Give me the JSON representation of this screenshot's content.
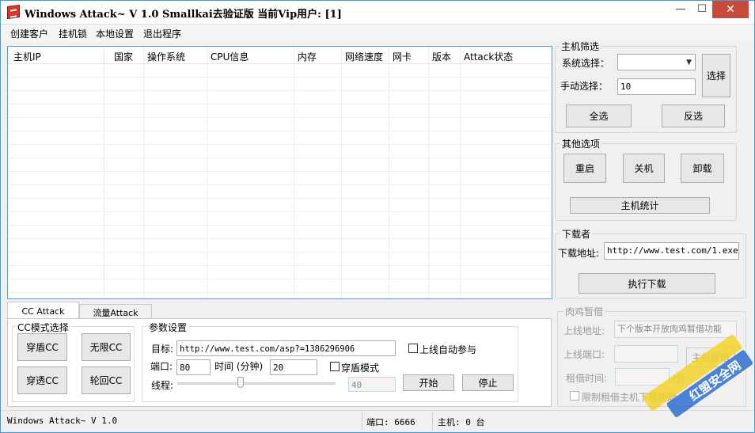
{
  "window": {
    "title": "Windows Attack~  V 1.0 Smallkai去验证版 当前Vip用户: [1]",
    "minimize": "—",
    "maximize": "☐",
    "close": "✕"
  },
  "menu": [
    "创建客户",
    "挂机锁",
    "本地设置",
    "退出程序"
  ],
  "hostlist": {
    "columns": [
      "主机IP",
      "国家",
      "操作系统",
      "CPU信息",
      "内存",
      "网络速度",
      "网卡",
      "版本",
      "Attack状态"
    ]
  },
  "host_filter": {
    "title": "主机筛选",
    "system_select_label": "系统选择：",
    "system_select_value": "",
    "manual_select_label": "手动选择：",
    "manual_select_value": "10",
    "select_button": "选择",
    "select_all": "全选",
    "invert": "反选"
  },
  "other_options": {
    "title": "其他选项",
    "restart": "重启",
    "shutdown": "关机",
    "uninstall": "卸载",
    "host_stats": "主机统计"
  },
  "downloader": {
    "title": "下载者",
    "url_label": "下载地址:",
    "url_value": "http://www.test.com/1.exe",
    "execute": "执行下载"
  },
  "borrow": {
    "title": "肉鸡暂借",
    "online_addr_label": "上线地址:",
    "online_addr_value": "下个版本开放肉鸡暂借功能",
    "online_port_label": "上线端口:",
    "online_port_value": "",
    "host_button": "主机暂借",
    "borrow_time_label": "租借时间:",
    "borrow_time_value": "",
    "minute_unit": "/分",
    "limit_download": "限制租借主机下载功能"
  },
  "tabs": [
    "CC Attack",
    "流量Attack"
  ],
  "cc_mode": {
    "title": "CC模式选择",
    "shield_cc": "穿盾CC",
    "unlimited_cc": "无限CC",
    "penetrate_cc": "穿透CC",
    "rotate_cc": "轮回CC"
  },
  "params": {
    "title": "参数设置",
    "target_label": "目标:",
    "target_value": "http://www.test.com/asp?=1386296906",
    "auto_join": "上线自动参与",
    "port_label": "端口:",
    "port_value": "80",
    "time_label": "时间 (分钟)",
    "time_value": "20",
    "shield_mode": "穿盾模式",
    "threads_label": "线程:",
    "threads_value": "40",
    "threads_level": 0.4,
    "start": "开始",
    "stop": "停止"
  },
  "status": {
    "version": "Windows Attack~  V 1.0",
    "port": "端口: 6666",
    "hosts": "主机: 0 台"
  },
  "watermark": {
    "text1": "红盟安全网",
    "color_blue": "#2f6fd0",
    "color_yellow": "#f2d22c"
  },
  "colors": {
    "accent_border": "#3aa0de",
    "close_button": "#c74b3b"
  }
}
